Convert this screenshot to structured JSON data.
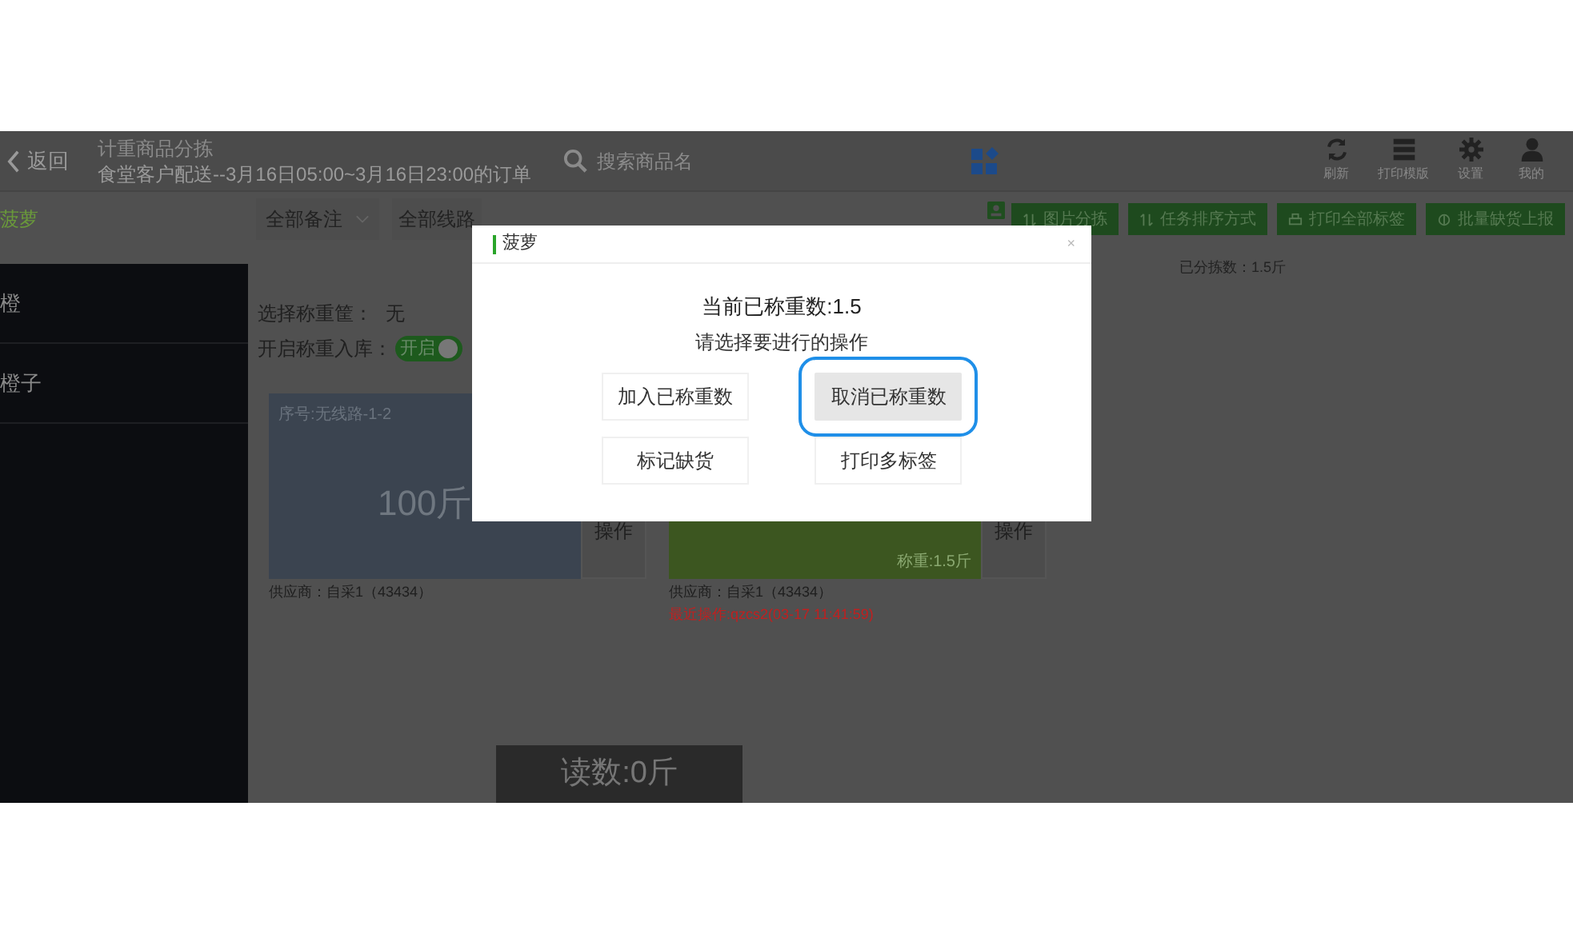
{
  "header": {
    "back": "返回",
    "title": "计重商品分拣",
    "subtitle": "食堂客户配送--3月16日05:00~3月16日23:00的订单",
    "search_placeholder": "搜索商品名",
    "tools": [
      {
        "kind": "refresh",
        "label": "刷新"
      },
      {
        "kind": "print",
        "label": "打印模版"
      },
      {
        "kind": "settings",
        "label": "设置"
      },
      {
        "kind": "user",
        "label": "我的"
      }
    ]
  },
  "toolbar": {
    "product": "菠萝",
    "note_filter": "全部备注",
    "route_filter": "全部线路",
    "actions": [
      "图片分拣",
      "任务排序方式",
      "打印全部标签",
      "批量缺货上报"
    ],
    "sorted_count": "已分拣数：1.5斤"
  },
  "sidebar": {
    "items": [
      {
        "label": "橙"
      },
      {
        "label": "橙子"
      }
    ]
  },
  "weigh": {
    "basket_label": "选择称重筐：",
    "basket_value": "无",
    "stock_label": "开启称重入库：",
    "stock_toggle": {
      "label": "开启",
      "on": true
    }
  },
  "cards": [
    {
      "weighed": false,
      "sequence": "序号:无线路-1-2",
      "amount": "100斤",
      "action": "操作",
      "supplier": "供应商：自采1（43434）"
    },
    {
      "weighed": true,
      "weight": "称重:1.5斤",
      "action": "操作",
      "supplier": "供应商：自采1（43434）",
      "last_operation": "最近操作:qzcs2(03-17 11:41:59)"
    }
  ],
  "reading": "读数:0斤",
  "dialog": {
    "title": "菠萝",
    "close": "×",
    "current": "当前已称重数:1.5",
    "prompt": "请选择要进行的操作",
    "buttons": [
      {
        "label": "加入已称重数",
        "focused": false
      },
      {
        "label": "取消已称重数",
        "focused": true
      },
      {
        "label": "标记缺货",
        "focused": false
      },
      {
        "label": "打印多标签",
        "focused": false
      }
    ]
  }
}
